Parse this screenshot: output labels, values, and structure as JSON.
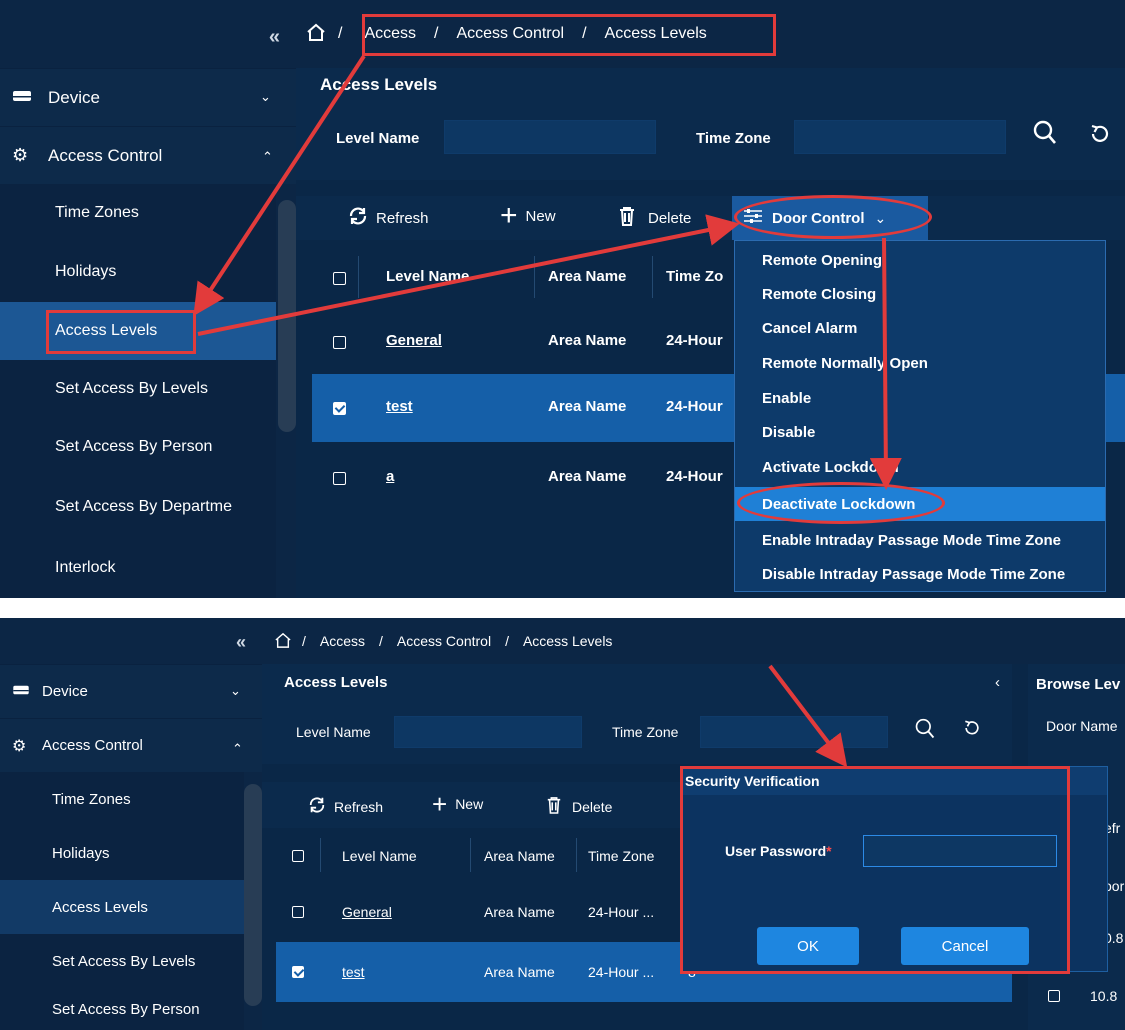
{
  "top": {
    "collapse_icon": "«",
    "breadcrumb": [
      "Access",
      "Access Control",
      "Access Levels"
    ],
    "breadcrumb_sep": "/",
    "panel_title": "Access Levels",
    "search": {
      "level_name_label": "Level Name",
      "level_name_value": "",
      "time_zone_label": "Time Zone",
      "time_zone_value": ""
    },
    "sidebar": {
      "device_label": "Device",
      "access_control_label": "Access Control",
      "items": [
        "Time Zones",
        "Holidays",
        "Access Levels",
        "Set Access By Levels",
        "Set Access By Person",
        "Set Access By Departme",
        "Interlock"
      ],
      "active_item": "Access Levels"
    },
    "toolbar": {
      "refresh": "Refresh",
      "new": "New",
      "delete": "Delete",
      "door_control": "Door Control"
    },
    "columns": [
      "Level Name",
      "Area Name",
      "Time Zo"
    ],
    "rows": [
      {
        "name": "General",
        "area": "Area Name",
        "tz": "24-Hour",
        "checked": false
      },
      {
        "name": "test",
        "area": "Area Name",
        "tz": "24-Hour",
        "checked": true
      },
      {
        "name": "a",
        "area": "Area Name",
        "tz": "24-Hour",
        "checked": false
      }
    ],
    "door_menu": [
      "Remote Opening",
      "Remote Closing",
      "Cancel Alarm",
      "Remote Normally Open",
      "Enable",
      "Disable",
      "Activate Lockdown",
      "Deactivate Lockdown",
      "Enable Intraday Passage Mode Time Zone",
      "Disable Intraday Passage Mode Time Zone"
    ],
    "door_menu_active": "Deactivate Lockdown"
  },
  "bottom": {
    "collapse_icon": "«",
    "breadcrumb": [
      "Access",
      "Access Control",
      "Access Levels"
    ],
    "breadcrumb_sep": "/",
    "panel_title": "Access Levels",
    "right_panel_title": "Browse Lev",
    "right_panel_field": "Door Name",
    "right_panel_cells": [
      "efr",
      "oor",
      "0.8",
      "10.8"
    ],
    "search": {
      "level_name_label": "Level Name",
      "time_zone_label": "Time Zone"
    },
    "sidebar": {
      "device_label": "Device",
      "access_control_label": "Access Control",
      "items": [
        "Time Zones",
        "Holidays",
        "Access Levels",
        "Set Access By Levels",
        "Set Access By Person"
      ],
      "active_item": "Access Levels"
    },
    "toolbar": {
      "refresh": "Refresh",
      "new": "New",
      "delete": "Delete"
    },
    "columns": [
      "Level Name",
      "Area Name",
      "Time Zone"
    ],
    "rows": [
      {
        "name": "General",
        "area": "Area Name",
        "tz": "24-Hour ...",
        "checked": false
      },
      {
        "name": "test",
        "area": "Area Name",
        "tz": "24-Hour ...",
        "extra": "8",
        "checked": true
      }
    ],
    "dialog": {
      "title": "Security Verification",
      "close": "×",
      "password_label": "User Password",
      "required_mark": "*",
      "password_value": "",
      "ok": "OK",
      "cancel": "Cancel"
    }
  },
  "colors": {
    "accent": "#1e86e0",
    "annotation_red": "#e23b3b",
    "panel_bg": "#0a2747",
    "selected_row": "#155fa8"
  }
}
